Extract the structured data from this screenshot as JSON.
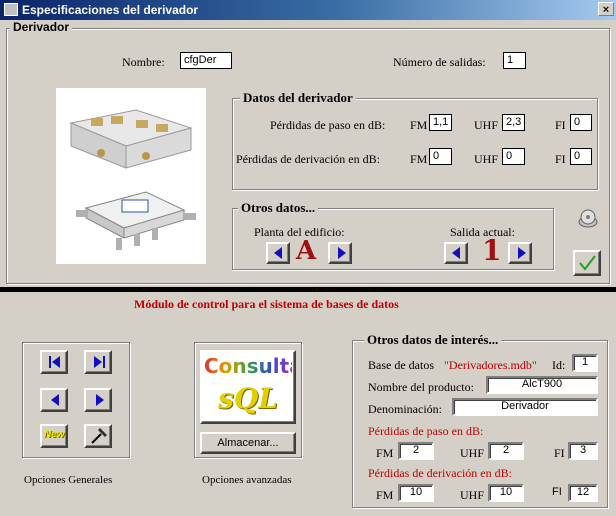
{
  "window": {
    "title": "Especificaciones del derivador",
    "close_label": "×"
  },
  "derivador": {
    "legend": "Derivador",
    "nombre_label": "Nombre:",
    "nombre_value": "cfgDer",
    "salidas_label": "Número de salidas:",
    "salidas_value": "1"
  },
  "datos": {
    "legend": "Datos del derivador",
    "paso_label": "Pérdidas de paso en dB:",
    "derivacion_label": "Pérdidas de derivación en dB:",
    "fm_label": "FM",
    "uhf_label": "UHF",
    "fi_label": "FI",
    "paso_fm": "1,1",
    "paso_uhf": "2,3",
    "paso_fi": "0",
    "deriv_fm": "0",
    "deriv_uhf": "0",
    "deriv_fi": "0"
  },
  "otros": {
    "legend": "Otros datos...",
    "planta_label": "Planta del edificio:",
    "planta_value": "A",
    "salida_label": "Salida actual:",
    "salida_value": "1"
  },
  "modulo": {
    "title": "Módulo de control para el sistema de bases de datos"
  },
  "nav": {
    "generales_label": "Opciones Generales",
    "avanzadas_label": "Opciones avanzadas",
    "consulta_line1": "Consulta",
    "consulta_line2": "sQL",
    "almacenar_label": "Almacenar...",
    "new_label": "New"
  },
  "interes": {
    "legend": "Otros datos de interés...",
    "base_label": "Base de datos",
    "base_value": "\"Derivadores.mdb\"",
    "id_label": "Id:",
    "id_value": "1",
    "producto_label": "Nombre del producto:",
    "producto_value": "AlcT900",
    "denominacion_label": "Denominación:",
    "denominacion_value": "Derivador",
    "paso_label": "Pérdidas de paso en dB:",
    "derivacion_label": "Pérdidas de derivación en dB:",
    "fm_label": "FM",
    "uhf_label": "UHF",
    "fi_label": "FI",
    "paso_fm": "2",
    "paso_uhf": "2",
    "paso_fi": "3",
    "deriv_fm": "10",
    "deriv_uhf": "10",
    "deriv_fi": "12"
  },
  "colors": {
    "accent_red": "#c00000",
    "arrow_blue": "#1010c0",
    "title_blue": "#0a246a"
  }
}
